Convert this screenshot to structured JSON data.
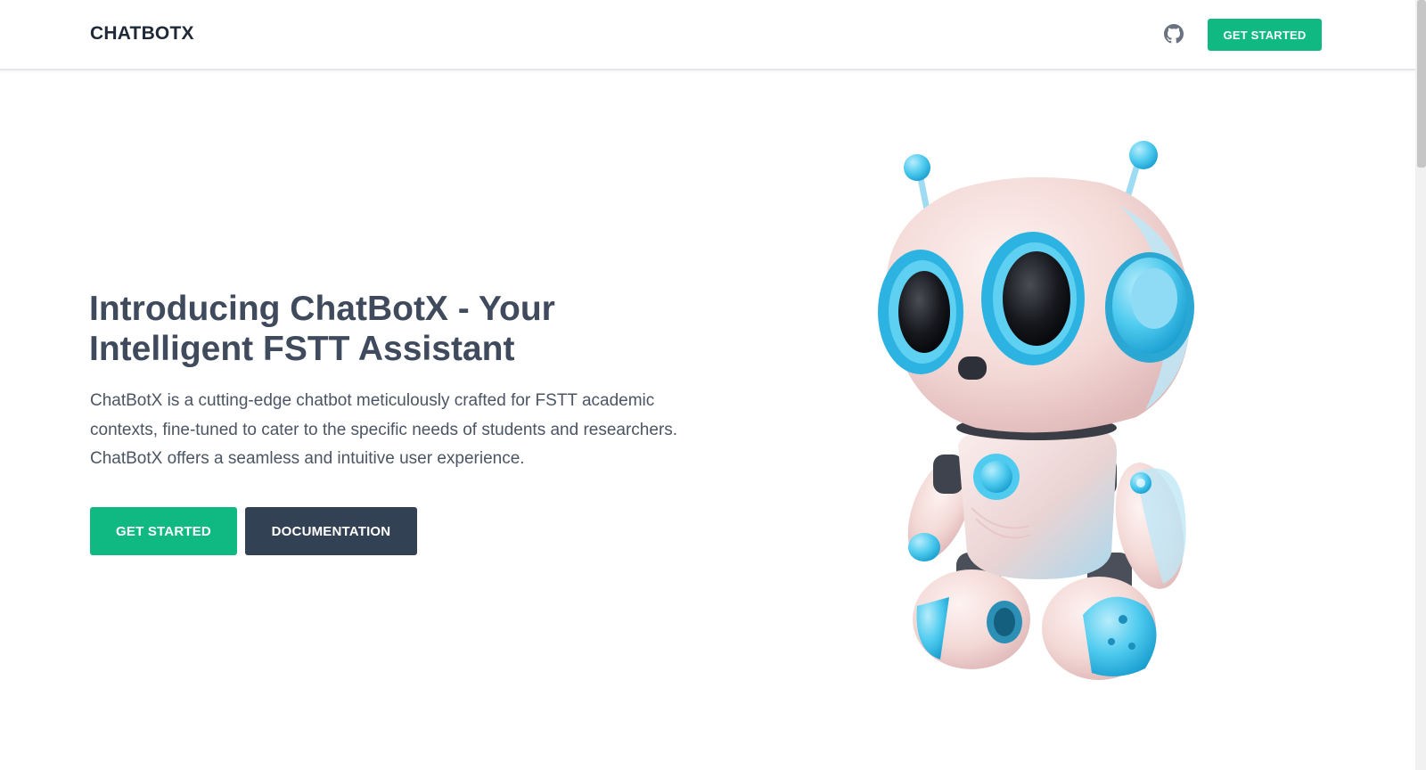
{
  "header": {
    "brand": "CHATBOTX",
    "github_icon": "github-icon",
    "cta_label": "GET STARTED"
  },
  "hero": {
    "title_line1": "Introducing ChatBotX - Your",
    "title_line2": "Intelligent FSTT Assistant",
    "description": "ChatBotX is a cutting-edge chatbot meticulously crafted for FSTT academic contexts, fine-tuned to cater to the specific needs of students and researchers. ChatBotX offers a seamless and intuitive user experience.",
    "primary_button": "GET STARTED",
    "secondary_button": "DOCUMENTATION"
  },
  "colors": {
    "accent_green": "#10b981",
    "dark_button": "#334155",
    "robot_cyan": "#3bc3ea"
  }
}
